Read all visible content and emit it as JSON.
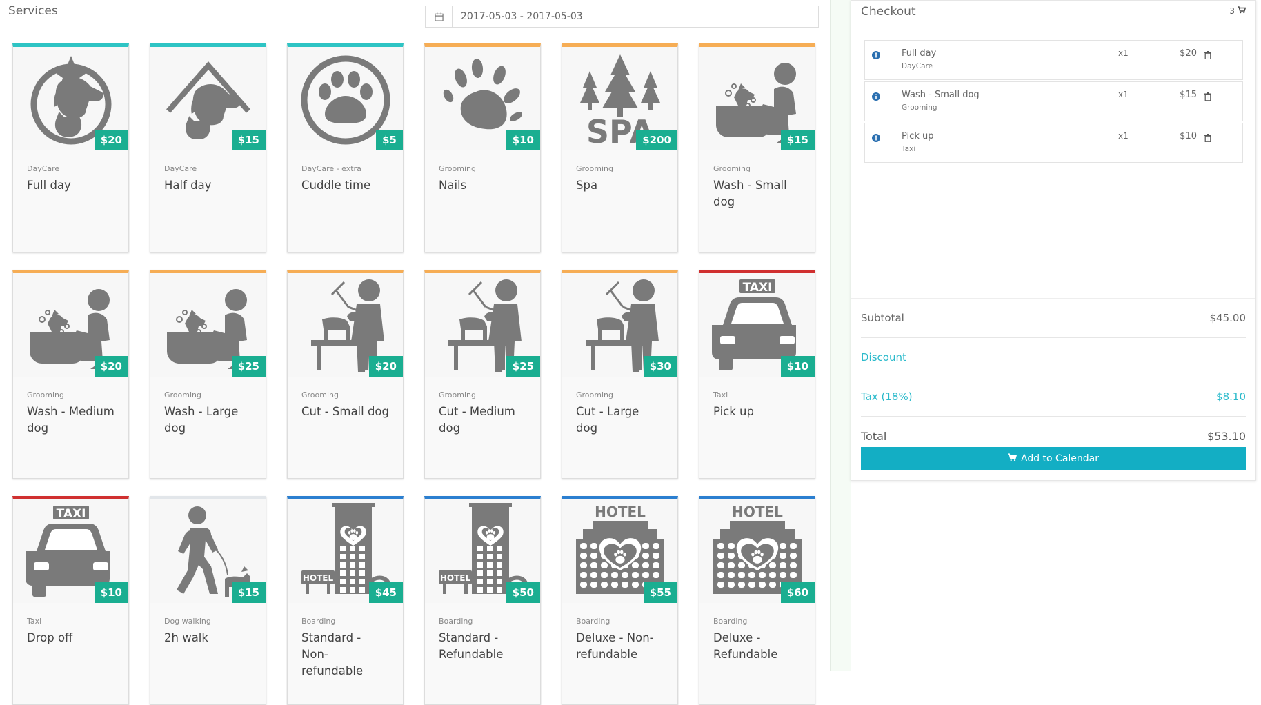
{
  "header": {
    "title": "Services",
    "date_range": "2017-05-03 - 2017-05-03"
  },
  "colors": {
    "price_badge": "#1aae91",
    "daycare": "#2ec4c4",
    "grooming": "#f6ad55",
    "taxi": "#d03030",
    "dog_walking": "#e2e6ea",
    "boarding": "#2b7fd0",
    "accent": "#13aec4"
  },
  "services": [
    {
      "category": "DayCare",
      "name": "Full day",
      "price": "$20",
      "icon": "dog-cat-star-circle-icon",
      "color": "#2ec4c4"
    },
    {
      "category": "DayCare",
      "name": "Half day",
      "price": "$15",
      "icon": "dog-cat-roof-icon",
      "color": "#2ec4c4"
    },
    {
      "category": "DayCare - extra",
      "name": "Cuddle time",
      "price": "$5",
      "icon": "paw-circle-icon",
      "color": "#2ec4c4"
    },
    {
      "category": "Grooming",
      "name": "Nails",
      "price": "$10",
      "icon": "paw-icon",
      "color": "#f6ad55"
    },
    {
      "category": "Grooming",
      "name": "Spa",
      "price": "$200",
      "icon": "spa-trees-icon",
      "color": "#f6ad55"
    },
    {
      "category": "Grooming",
      "name": "Wash - Small dog",
      "price": "$15",
      "icon": "dog-wash-icon",
      "color": "#f6ad55"
    },
    {
      "category": "Grooming",
      "name": "Wash - Medium dog",
      "price": "$20",
      "icon": "dog-wash-icon",
      "color": "#f6ad55"
    },
    {
      "category": "Grooming",
      "name": "Wash - Large dog",
      "price": "$25",
      "icon": "dog-wash-icon",
      "color": "#f6ad55"
    },
    {
      "category": "Grooming",
      "name": "Cut - Small dog",
      "price": "$20",
      "icon": "dog-groomer-table-icon",
      "color": "#f6ad55"
    },
    {
      "category": "Grooming",
      "name": "Cut - Medium dog",
      "price": "$25",
      "icon": "dog-groomer-table-icon",
      "color": "#f6ad55"
    },
    {
      "category": "Grooming",
      "name": "Cut - Large dog",
      "price": "$30",
      "icon": "dog-groomer-table-icon",
      "color": "#f6ad55"
    },
    {
      "category": "Taxi",
      "name": "Pick up",
      "price": "$10",
      "icon": "taxi-icon",
      "color": "#d03030",
      "icon_text": "TAXI"
    },
    {
      "category": "Taxi",
      "name": "Drop off",
      "price": "$10",
      "icon": "taxi-icon",
      "color": "#d03030",
      "icon_text": "TAXI"
    },
    {
      "category": "Dog walking",
      "name": "2h walk",
      "price": "$15",
      "icon": "dog-walking-icon",
      "color": "#e2e6ea"
    },
    {
      "category": "Boarding",
      "name": "Standard - Non-refundable",
      "price": "$45",
      "icon": "hotel-tower-icon",
      "color": "#2b7fd0",
      "icon_text": "HOTEL"
    },
    {
      "category": "Boarding",
      "name": "Standard - Refundable",
      "price": "$50",
      "icon": "hotel-tower-icon",
      "color": "#2b7fd0",
      "icon_text": "HOTEL"
    },
    {
      "category": "Boarding",
      "name": "Deluxe - Non-refundable",
      "price": "$55",
      "icon": "hotel-deluxe-icon",
      "color": "#2b7fd0",
      "icon_text": "HOTEL"
    },
    {
      "category": "Boarding",
      "name": "Deluxe - Refundable",
      "price": "$60",
      "icon": "hotel-deluxe-icon",
      "color": "#2b7fd0",
      "icon_text": "HOTEL"
    }
  ],
  "checkout": {
    "title": "Checkout",
    "cart_count": "3",
    "items": [
      {
        "name": "Full day",
        "category": "DayCare",
        "qty": "x1",
        "price": "$20"
      },
      {
        "name": "Wash - Small dog",
        "category": "Grooming",
        "qty": "x1",
        "price": "$15"
      },
      {
        "name": "Pick up",
        "category": "Taxi",
        "qty": "x1",
        "price": "$10"
      }
    ],
    "subtotal_label": "Subtotal",
    "subtotal_value": "$45.00",
    "discount_label": "Discount",
    "tax_label": "Tax (18%)",
    "tax_value": "$8.10",
    "total_label": "Total",
    "total_value": "$53.10",
    "add_button": "Add to Calendar"
  }
}
